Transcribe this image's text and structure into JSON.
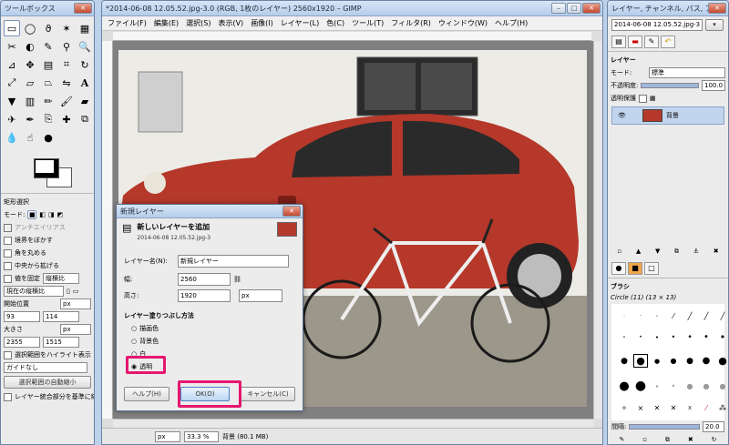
{
  "toolbox": {
    "title": "ツールボックス",
    "tool_options_title": "矩形選択",
    "mode_label": "モード:",
    "antialias": "アンチエイリアス",
    "feather": "境界をぼかす",
    "rounded": "角を丸める",
    "expand_center": "中央から拡げる",
    "fixed_label": "値を固定",
    "fixed_value": "縦横比",
    "ratio_value": "現在の縦横比",
    "position_label": "開始位置",
    "unit": "px",
    "pos_x": "93",
    "pos_y": "114",
    "size_label": "大きさ",
    "size_w": "2355",
    "size_h": "1515",
    "highlight": "選択範囲をハイライト表示",
    "guides": "ガイドなし",
    "auto_shrink": "選択範囲の自動縮小",
    "merge_layers": "レイヤー統合部分を基準に縮小"
  },
  "main": {
    "title": "*2014-06-08 12.05.52.jpg-3.0 (RGB, 1枚のレイヤー) 2560x1920 – GIMP",
    "menus": [
      "ファイル(F)",
      "編集(E)",
      "選択(S)",
      "表示(V)",
      "画像(I)",
      "レイヤー(L)",
      "色(C)",
      "ツール(T)",
      "フィルタ(R)",
      "ウィンドウ(W)",
      "ヘルプ(H)"
    ],
    "status_unit": "px",
    "zoom": "33.3 %",
    "status_text": "背景 (80.1 MB)"
  },
  "dialog": {
    "title": "新規レイヤー",
    "heading": "新しいレイヤーを追加",
    "subheading": "2014-06-08 12.05.52.jpg-3",
    "name_label": "レイヤー名(N):",
    "name_value": "新規レイヤー",
    "width_label": "幅:",
    "width_value": "2560",
    "height_label": "高さ:",
    "height_value": "1920",
    "unit": "px",
    "fill_label": "レイヤー塗りつぶし方法",
    "fill_options": [
      "描画色",
      "背景色",
      "白",
      "透明"
    ],
    "help_button": "ヘルプ(H)",
    "ok_button": "OK(O)",
    "cancel_button": "キャンセル(C)"
  },
  "dock": {
    "title": "レイヤー, チャンネル, パス, ア…",
    "image_select": "2014-06-08 12.05.52.jpg-3",
    "layers_title": "レイヤー",
    "mode_label": "モード:",
    "mode_value": "標準",
    "opacity_label": "不透明度:",
    "opacity_value": "100.0",
    "lock_label": "透明保護",
    "layer_name": "背景",
    "brushes_title": "ブラシ",
    "brush_name": "Circle (11) (13 × 13)",
    "spacing_label": "間隔:",
    "spacing_value": "20.0"
  },
  "colors": {
    "accent": "#e5176f",
    "car": "#b63a2c"
  }
}
